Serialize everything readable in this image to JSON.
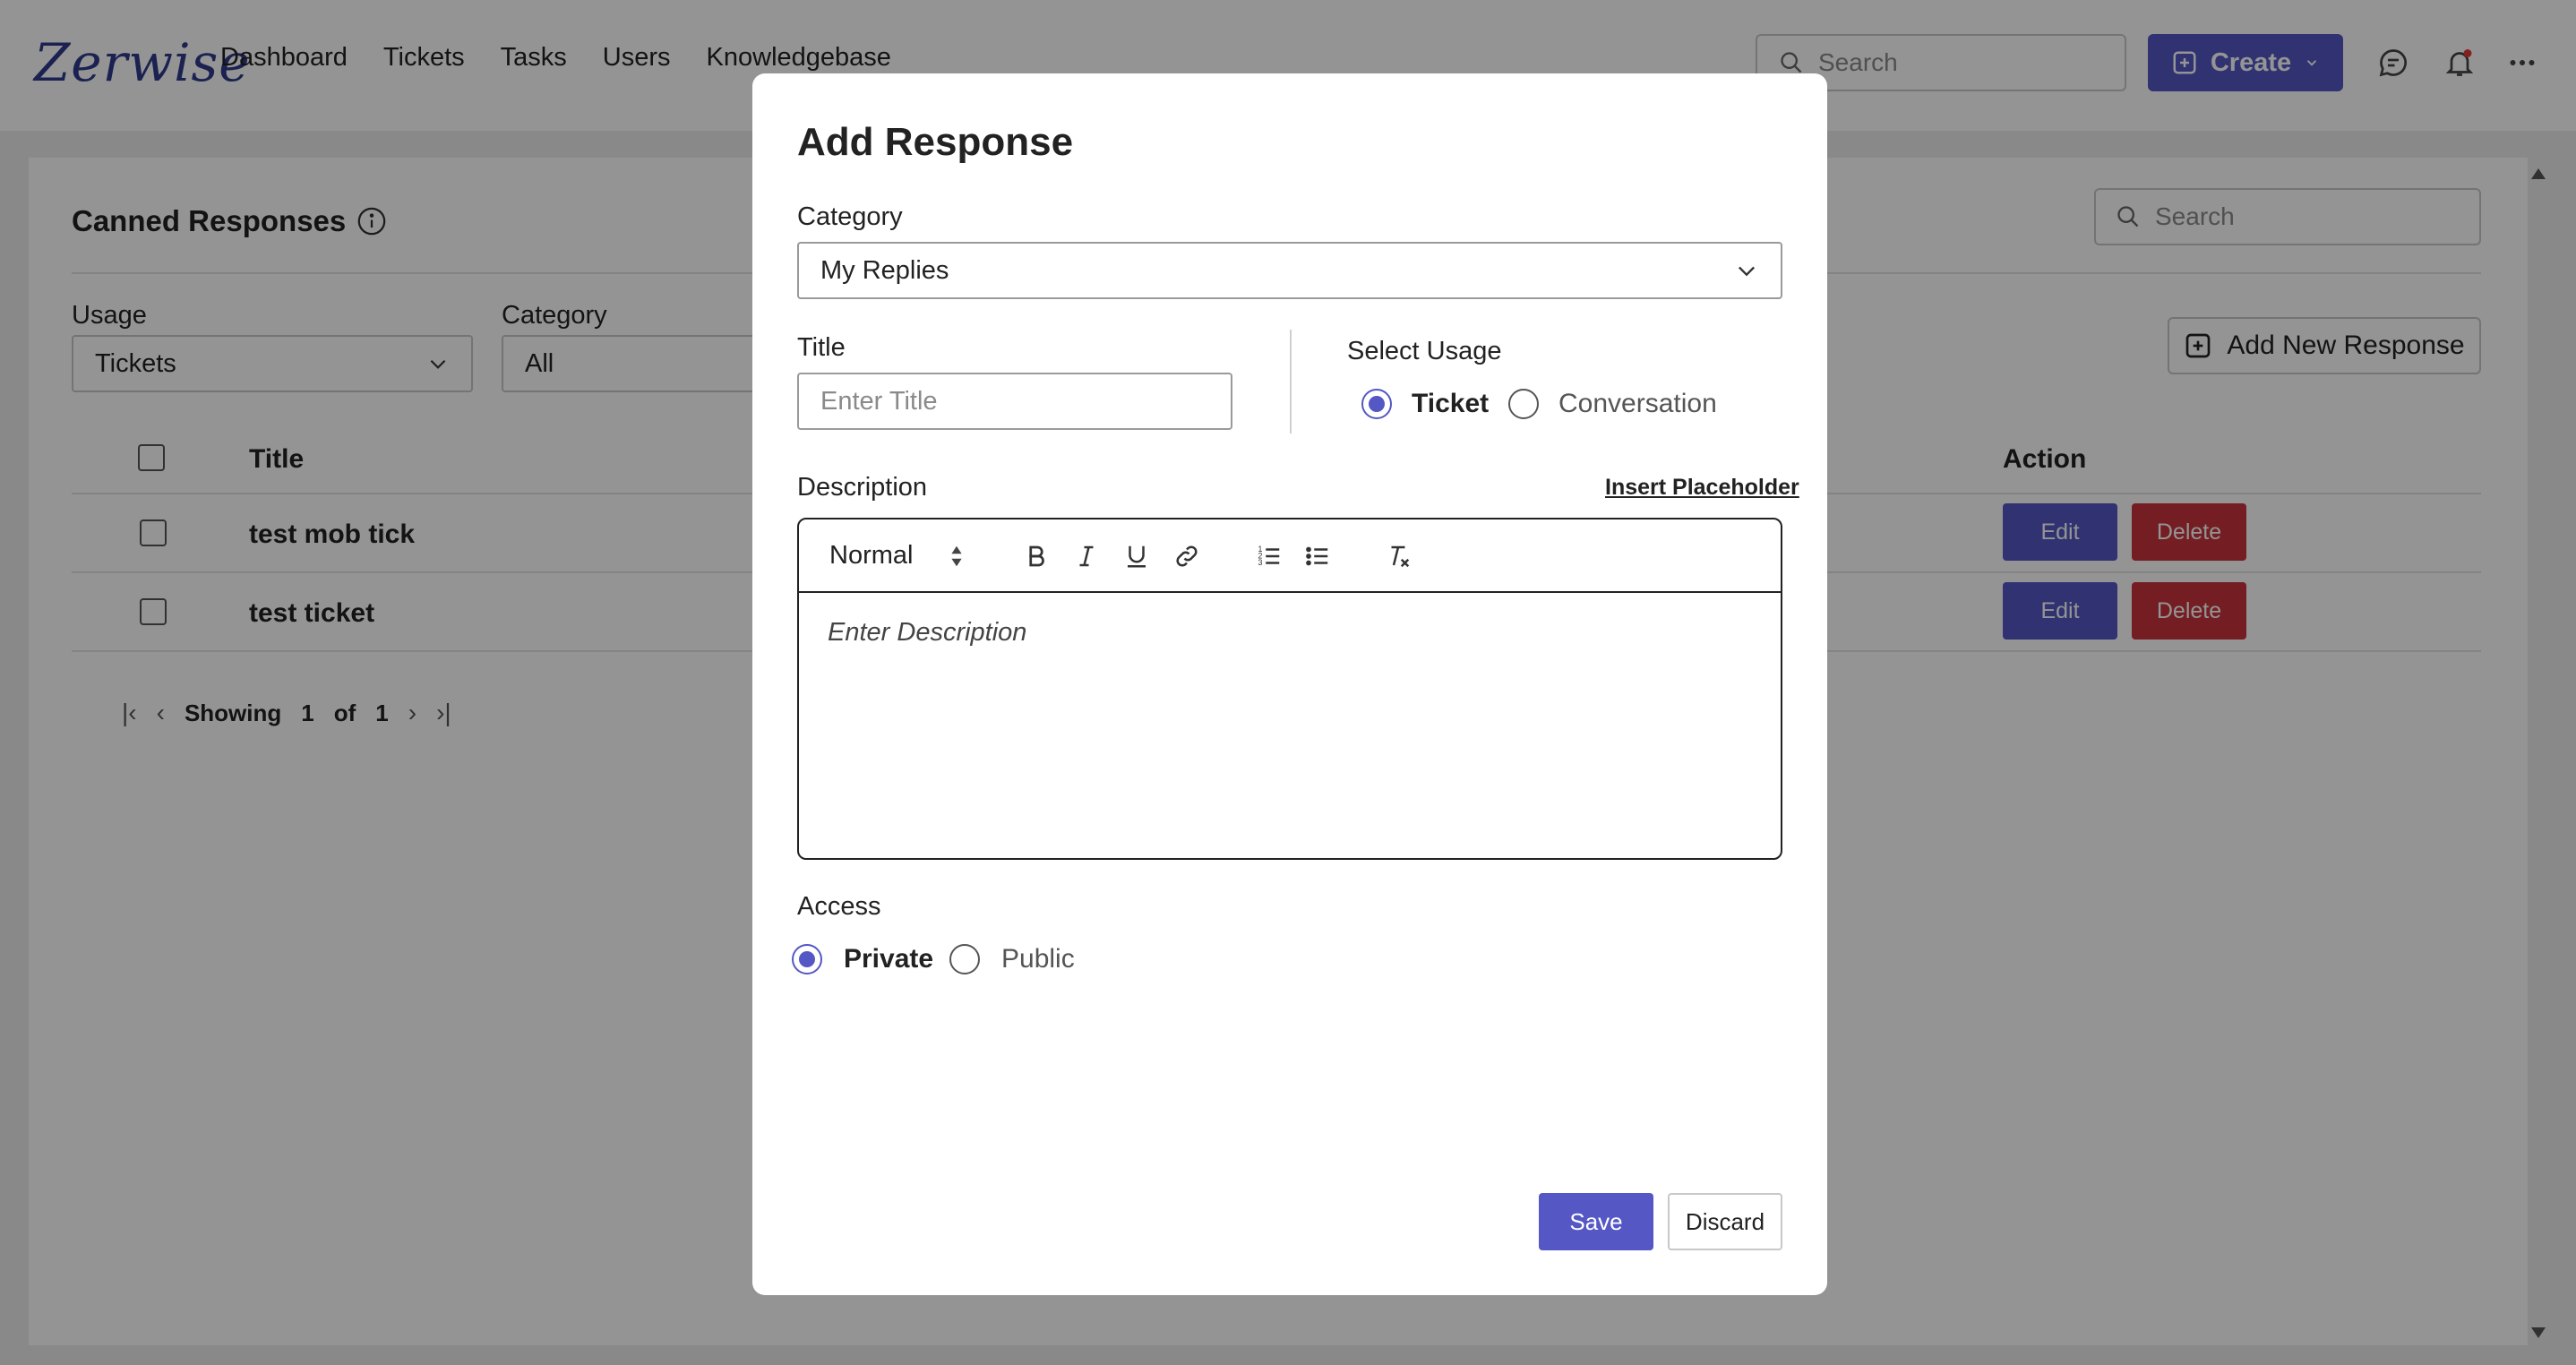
{
  "app": {
    "logo_text": "Zerwise",
    "nav": [
      "Dashboard",
      "Tickets",
      "Tasks",
      "Users",
      "Knowledgebase"
    ],
    "search_placeholder": "Search",
    "create_label": "Create"
  },
  "page": {
    "title": "Canned Responses",
    "search_placeholder": "Search",
    "filters": {
      "usage_label": "Usage",
      "usage_value": "Tickets",
      "category_label": "Category",
      "category_value": "All"
    },
    "add_new_label": "Add New Response",
    "table": {
      "col_title": "Title",
      "col_action": "Action",
      "rows": [
        {
          "title": "test mob tick"
        },
        {
          "title": "test ticket"
        }
      ],
      "edit_label": "Edit",
      "delete_label": "Delete"
    },
    "pagination": {
      "showing": "Showing",
      "current": "1",
      "of": "of",
      "total": "1"
    }
  },
  "modal": {
    "title": "Add Response",
    "category_label": "Category",
    "category_value": "My Replies",
    "title_label": "Title",
    "title_placeholder": "Enter Title",
    "usage_label": "Select Usage",
    "usage_options": [
      {
        "label": "Ticket",
        "selected": true
      },
      {
        "label": "Conversation",
        "selected": false
      }
    ],
    "description_label": "Description",
    "insert_placeholder": "Insert Placeholder",
    "editor": {
      "format": "Normal",
      "placeholder": "Enter Description"
    },
    "access_label": "Access",
    "access_options": [
      {
        "label": "Private",
        "selected": true
      },
      {
        "label": "Public",
        "selected": false
      }
    ],
    "save_label": "Save",
    "discard_label": "Discard"
  },
  "colors": {
    "primary": "#5457c4",
    "danger": "#c8323c",
    "notification_dot": "#e03a3a"
  }
}
